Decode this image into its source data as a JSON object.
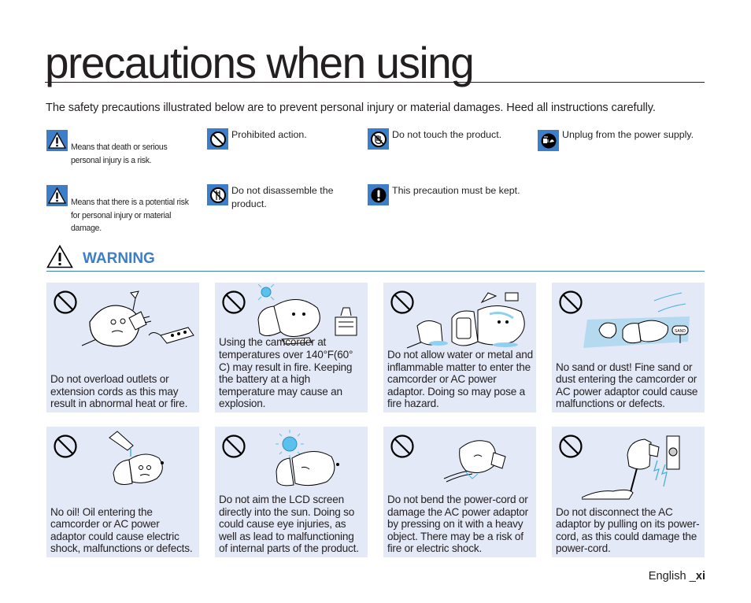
{
  "page": {
    "title": "precautions when using",
    "intro": "The safety precautions illustrated below are to prevent personal injury or material damages. Heed all instructions carefully."
  },
  "legend": [
    {
      "icon": "warning-triangle-icon",
      "text": "Means that death or serious personal injury is a risk."
    },
    {
      "icon": "prohibited-icon",
      "text": "Prohibited action."
    },
    {
      "icon": "do-not-touch-icon",
      "text": "Do not touch the product."
    },
    {
      "icon": "unplug-icon",
      "text": "Unplug from the power supply."
    },
    {
      "icon": "caution-triangle-icon",
      "text": "Means that there is a potential risk for personal injury or material damage."
    },
    {
      "icon": "do-not-disassemble-icon",
      "text": "Do not disassemble the product."
    },
    {
      "icon": "must-keep-icon",
      "text": "This precaution must be kept."
    }
  ],
  "warning": {
    "label": "WARNING",
    "accent_color": "#3d7ec9",
    "card_bg": "#e3e9f6",
    "cards": [
      {
        "illustration": "overloaded-outlet-illustration",
        "text": "Do not overload outlets or extension cords as this may result in abnormal heat or fire."
      },
      {
        "illustration": "hot-camcorder-illustration",
        "text": "Using the camcorder at temperatures over 140°F(60° C) may result in fire. Keeping the battery at a high temperature may cause an explosion."
      },
      {
        "illustration": "water-camcorder-illustration",
        "text": "Do not allow water or metal and inflammable matter to enter the camcorder or AC power adaptor. Doing so may pose a fire hazard."
      },
      {
        "illustration": "sand-camcorder-illustration",
        "text": "No sand or dust! Fine sand or dust entering the camcorder or AC power adaptor could cause malfunctions or defects."
      },
      {
        "illustration": "oil-camcorder-illustration",
        "text": "No oil! Oil entering the camcorder or AC power adaptor could cause electric shock, malfunctions or defects."
      },
      {
        "illustration": "sun-lcd-illustration",
        "text": "Do not aim the LCD screen directly into the sun. Doing so could cause eye injuries, as well as lead to malfunctioning of internal parts of the product."
      },
      {
        "illustration": "bent-cord-illustration",
        "text": "Do not bend the power-cord or damage the AC power adaptor by pressing on it with a heavy object. There may be a risk of fire or electric shock."
      },
      {
        "illustration": "pull-cord-illustration",
        "text": "Do not disconnect the AC adaptor by pulling on its power-cord, as this could damage the power-cord."
      }
    ],
    "sand_sign": "SAND"
  },
  "footer": {
    "language": "English _",
    "page_number": "xi"
  }
}
